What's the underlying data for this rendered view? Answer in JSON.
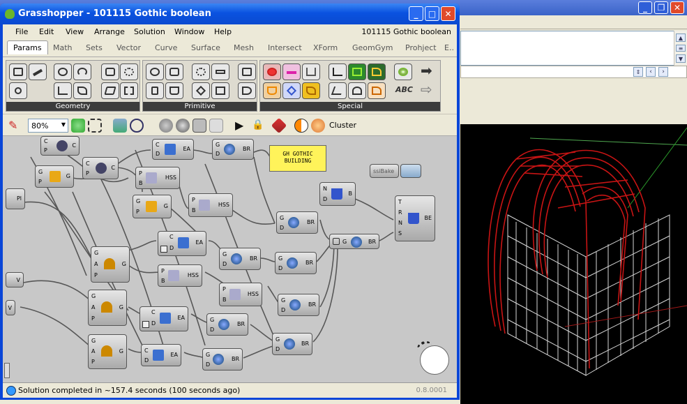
{
  "rhino": {
    "window_buttons": [
      "_",
      "❐",
      "✕"
    ]
  },
  "gh": {
    "title": "Grasshopper - 101115 Gothic boolean",
    "window_buttons": [
      "_",
      "□",
      "✕"
    ],
    "menu": [
      "File",
      "Edit",
      "View",
      "Arrange",
      "Solution",
      "Window",
      "Help"
    ],
    "doc_label": "101115 Gothic boolean",
    "tabs": [
      "Params",
      "Math",
      "Sets",
      "Vector",
      "Curve",
      "Surface",
      "Mesh",
      "Intersect",
      "XForm",
      "GeomGym",
      "Prohject",
      "E.."
    ],
    "active_tab": "Params",
    "panels": [
      "Geometry",
      "Primitive",
      "Special"
    ],
    "zoom": "80%",
    "cluster_label": "Cluster",
    "status": "Solution completed in ~157.4 seconds (100 seconds ago)",
    "version": "0.8.0001"
  },
  "canvas": {
    "note": "GH GOTHIC BUILDING",
    "bake_label": "ssiBake",
    "components": {
      "ea": "EA",
      "br": "BR",
      "hss": "HSS",
      "be": "BE",
      "b": "B",
      "g": "G",
      "c": "C",
      "pl": "Pl",
      "v": "V"
    }
  }
}
